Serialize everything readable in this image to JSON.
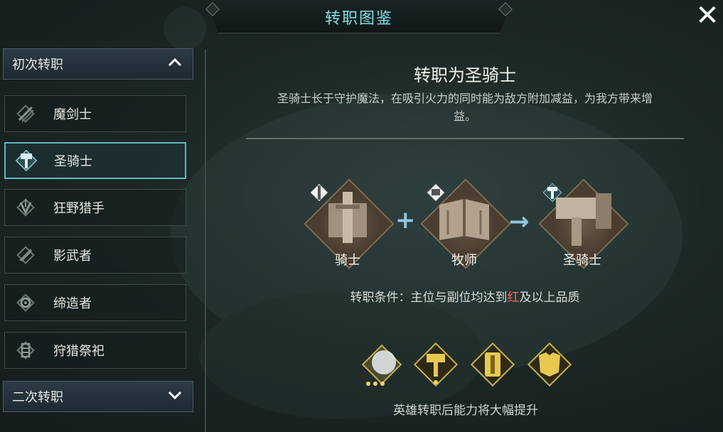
{
  "window": {
    "title": "转职图鉴",
    "close_icon": "close-icon"
  },
  "sidebar": {
    "group1": {
      "label": "初次转职",
      "expanded": true
    },
    "items": [
      {
        "label": "魔剑士",
        "icon": "sword-crossed-icon"
      },
      {
        "label": "圣骑士",
        "icon": "hammer-shield-icon",
        "active": true
      },
      {
        "label": "狂野猎手",
        "icon": "beast-claw-icon"
      },
      {
        "label": "影武者",
        "icon": "shadow-blade-icon"
      },
      {
        "label": "缔造者",
        "icon": "gear-forge-icon"
      },
      {
        "label": "狩猎祭祀",
        "icon": "totem-icon"
      }
    ],
    "group2": {
      "label": "二次转职",
      "expanded": false
    }
  },
  "main": {
    "heading": "转职为圣骑士",
    "description": "圣骑士长于守护魔法，在吸引火力的同时能为敌方附加减益，为我方带来增益。",
    "combo": {
      "left": {
        "label": "骑士",
        "icon": "knight-sword-icon"
      },
      "middle": {
        "label": "牧师",
        "icon": "book-icon"
      },
      "result": {
        "label": "圣骑士",
        "icon": "hammer-icon"
      },
      "plus": "+",
      "arrow": "→"
    },
    "condition": {
      "prefix": "转职条件：主位与副位均达到",
      "highlight": "红",
      "suffix": "及以上品质"
    },
    "rewards": [
      "glowing-orb-icon",
      "hammer-token-icon",
      "shield-token-icon",
      "armor-token-icon"
    ],
    "reward_caption": "英雄转职后能力将大幅提升"
  },
  "colors": {
    "accent": "#7fe0e8",
    "active_border": "#5fb8c0",
    "highlight_red": "#ff6464",
    "gold": "#e8c850"
  }
}
